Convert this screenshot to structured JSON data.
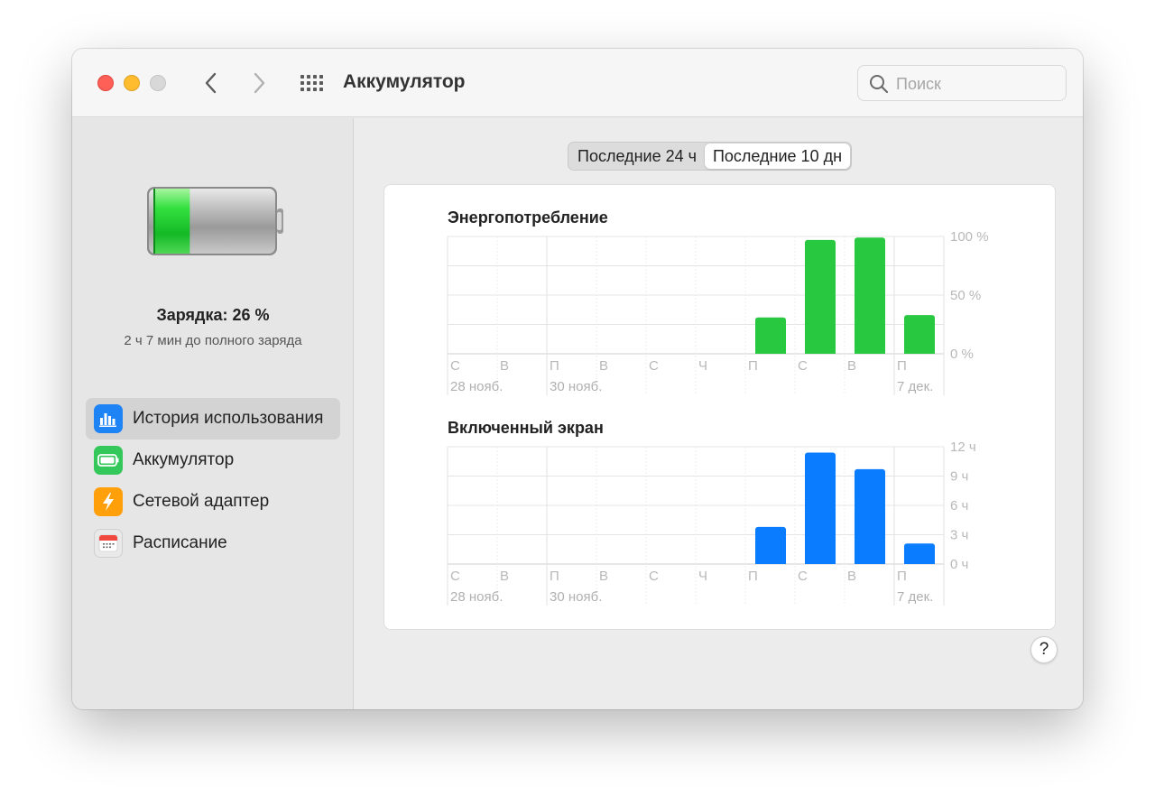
{
  "window": {
    "title": "Аккумулятор",
    "search_placeholder": "Поиск"
  },
  "sidebar": {
    "charge_title": "Зарядка: 26 %",
    "charge_subtitle": "2 ч 7 мин до полного заряда",
    "battery_level": 0.26,
    "items": [
      {
        "label": "История использования",
        "icon": "usage-history-icon",
        "selected": true
      },
      {
        "label": "Аккумулятор",
        "icon": "battery-icon",
        "selected": false
      },
      {
        "label": "Сетевой адаптер",
        "icon": "power-adapter-icon",
        "selected": false
      },
      {
        "label": "Расписание",
        "icon": "schedule-icon",
        "selected": false
      }
    ]
  },
  "tabs": [
    {
      "label": "Последние 24 ч",
      "active": false
    },
    {
      "label": "Последние 10 дн",
      "active": true
    }
  ],
  "help_label": "?",
  "colors": {
    "energy_bar": "#28c840",
    "screen_bar": "#0a7cff",
    "battery_green": "#2fd44a"
  },
  "chart_data": [
    {
      "type": "bar",
      "title": "Энергопотребление",
      "categories": [
        "С",
        "В",
        "П",
        "В",
        "С",
        "Ч",
        "П",
        "С",
        "В",
        "П"
      ],
      "date_labels": [
        "28 нояб.",
        "",
        "30 нояб.",
        "",
        "",
        "",
        "",
        "",
        "",
        "7 дек."
      ],
      "values": [
        0,
        0,
        0,
        0,
        0,
        0,
        31,
        97,
        99,
        33
      ],
      "ylim": [
        0,
        100
      ],
      "yticks": [
        "100 %",
        "50 %",
        "0 %"
      ],
      "ytick_values": [
        100,
        50,
        0
      ]
    },
    {
      "type": "bar",
      "title": "Включенный экран",
      "categories": [
        "С",
        "В",
        "П",
        "В",
        "С",
        "Ч",
        "П",
        "С",
        "В",
        "П"
      ],
      "date_labels": [
        "28 нояб.",
        "",
        "30 нояб.",
        "",
        "",
        "",
        "",
        "",
        "",
        "7 дек."
      ],
      "values": [
        0,
        0,
        0,
        0,
        0,
        0,
        3.8,
        11.4,
        9.7,
        2.1
      ],
      "ylim": [
        0,
        12
      ],
      "yticks": [
        "12 ч",
        "9 ч",
        "6 ч",
        "3 ч",
        "0 ч"
      ],
      "ytick_values": [
        12,
        9,
        6,
        3,
        0
      ]
    }
  ]
}
